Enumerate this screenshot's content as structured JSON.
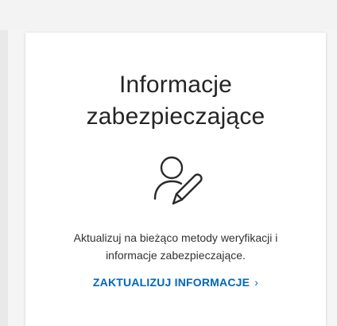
{
  "card": {
    "title_line1": "Informacje",
    "title_line2": "zabezpieczające",
    "icon": "user-edit-icon",
    "description_line1": "Aktualizuj na bieżąco metody weryfikacji i",
    "description_line2": "informacje zabezpieczające.",
    "link_label": "ZAKTUALIZUJ INFORMACJE",
    "link_chevron": "›"
  },
  "colors": {
    "link": "#0067b8",
    "title": "#252525",
    "text": "#323232"
  }
}
